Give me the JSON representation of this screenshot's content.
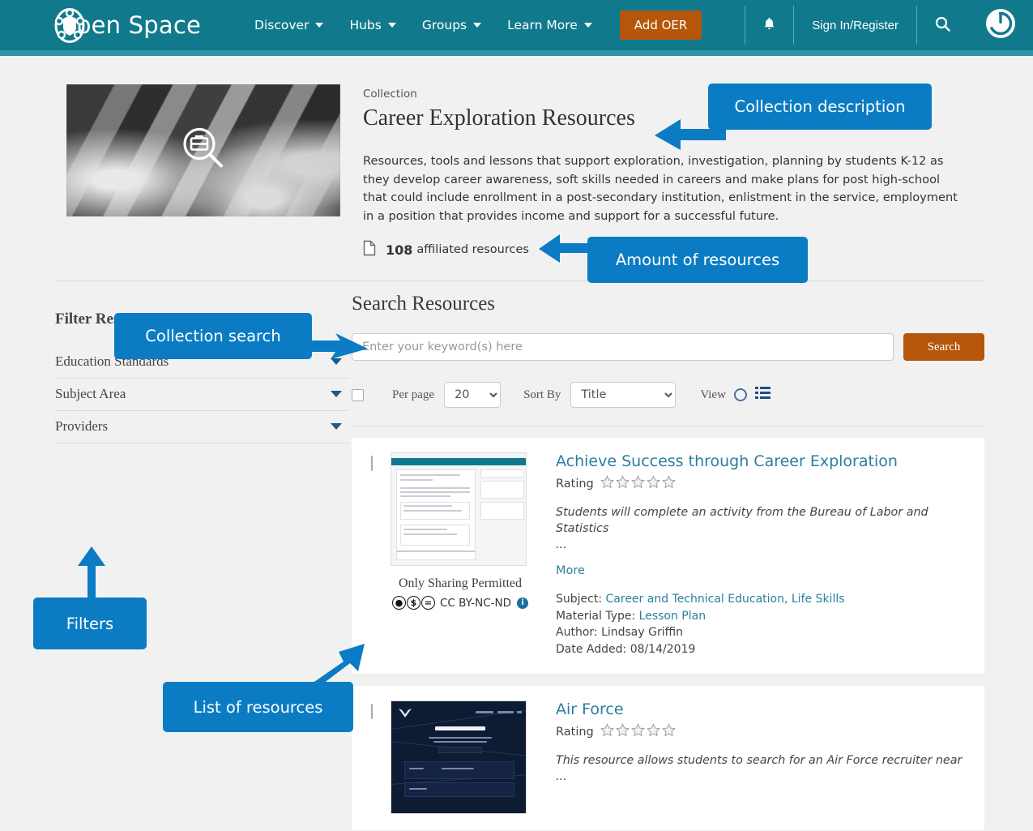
{
  "header": {
    "brand": "pen Space",
    "brand_logo_icon": "open-space-logo-icon",
    "nav": [
      {
        "label": "Discover",
        "caret": true
      },
      {
        "label": "Hubs",
        "caret": true
      },
      {
        "label": "Groups",
        "caret": true
      },
      {
        "label": "Learn More",
        "caret": true
      }
    ],
    "add_oer_label": "Add OER",
    "bell_icon": "bell-icon",
    "sign_in_label": "Sign In/Register",
    "search_icon": "search-icon",
    "power_icon": "power-icon",
    "bg_color": "#107a8c",
    "accent_orange": "#b5560a"
  },
  "collection": {
    "kicker": "Collection",
    "title": "Career Exploration Resources",
    "description": "Resources, tools and lessons that support exploration, investigation, planning by students K-12 as they develop career awareness, soft skills needed in careers and make plans for post high-school that could include enrollment in a post-secondary institution, enlistment in the service, employment in a position that provides income and support for a successful future.",
    "count": "108",
    "count_label": "affiliated resources",
    "doc_icon": "document-icon",
    "image_icon": "briefcase-magnifier-icon"
  },
  "search": {
    "heading": "Search Resources",
    "placeholder": "Enter your keyword(s) here",
    "value": "",
    "button_label": "Search"
  },
  "toolbar": {
    "select_all": false,
    "per_page_label": "Per page",
    "per_page_value": "20",
    "per_page_options": [
      "20"
    ],
    "sort_by_label": "Sort By",
    "sort_by_value": "Title",
    "sort_by_options": [
      "Title"
    ],
    "view_label": "View",
    "view_grid_icon": "circle-view-icon",
    "view_list_icon": "list-view-icon"
  },
  "filters": {
    "heading": "Filter Resources",
    "items": [
      {
        "label": "Education Standards"
      },
      {
        "label": "Subject Area"
      },
      {
        "label": "Providers"
      }
    ]
  },
  "resources": [
    {
      "title": "Achieve Success through Career Exploration",
      "rating_label": "Rating",
      "stars": 5,
      "stars_filled": 0,
      "abstract": "Students will complete an activity from the Bureau of Labor and Statistics",
      "ellipsis": "...",
      "more_label": "More",
      "subject_label": "Subject:",
      "subject_value": "Career and Technical Education, Life Skills",
      "material_label": "Material Type:",
      "material_value": "Lesson Plan",
      "author_label": "Author:",
      "author_value": "Lindsay Griffin",
      "date_label": "Date Added:",
      "date_value": "08/14/2019",
      "license_text": "Only Sharing Permitted",
      "license_code": "CC BY-NC-ND",
      "license_icons": [
        "cc-by-icon",
        "cc-nc-icon",
        "cc-nd-icon"
      ],
      "info_icon": "info-icon"
    },
    {
      "title": "Air Force",
      "rating_label": "Rating",
      "stars": 5,
      "stars_filled": 0,
      "abstract": "This resource allows students to search for an Air Force recruiter near ...",
      "thumb_text": "FIND A RECRUITER"
    }
  ],
  "annotations": [
    {
      "id": "collection-description",
      "label": "Collection description"
    },
    {
      "id": "amount-of-resources",
      "label": "Amount of resources"
    },
    {
      "id": "collection-search",
      "label": "Collection search"
    },
    {
      "id": "filters",
      "label": "Filters"
    },
    {
      "id": "list-of-resources",
      "label": "List of resources"
    }
  ],
  "annotation_color": "#0b7cc4"
}
